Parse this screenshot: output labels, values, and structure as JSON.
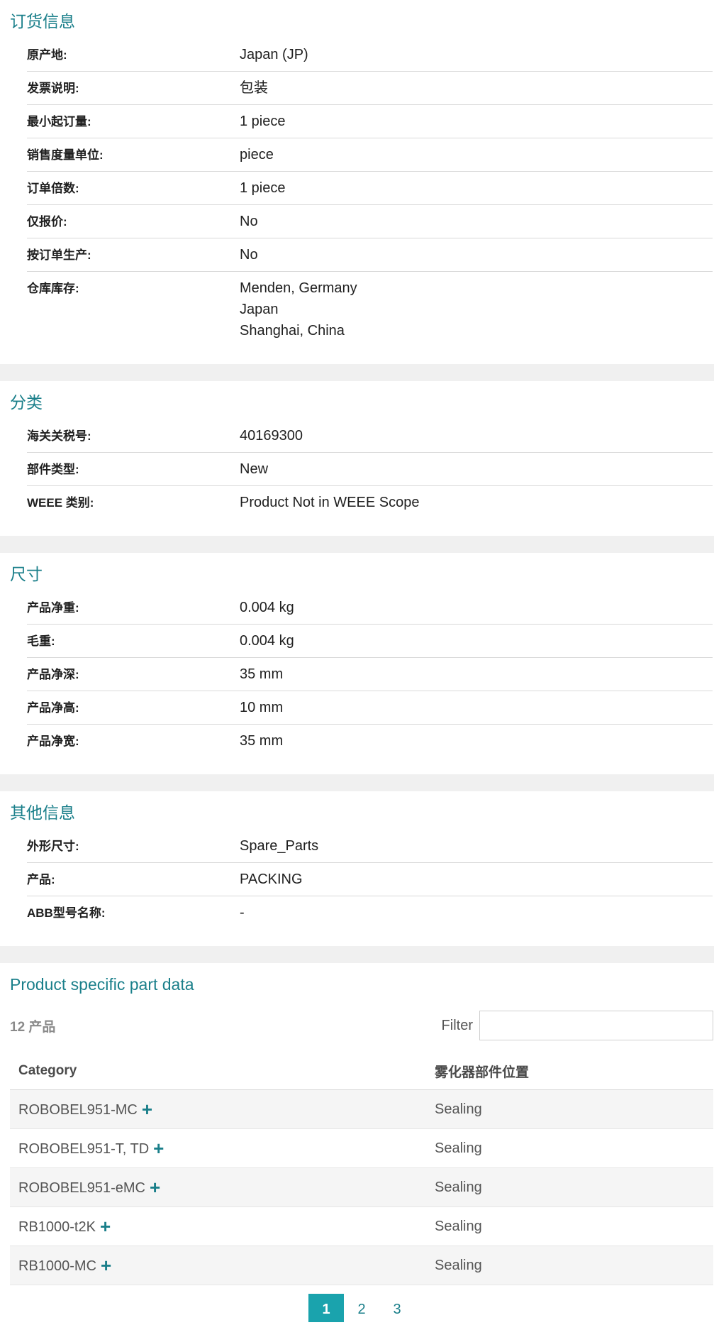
{
  "ordering": {
    "title": "订货信息",
    "rows": [
      {
        "label": "原产地:",
        "values": [
          "Japan (JP)"
        ]
      },
      {
        "label": "发票说明:",
        "values": [
          "包装"
        ]
      },
      {
        "label": "最小起订量:",
        "values": [
          "1 piece"
        ]
      },
      {
        "label": "销售度量单位:",
        "values": [
          "piece"
        ]
      },
      {
        "label": "订单倍数:",
        "values": [
          "1 piece"
        ]
      },
      {
        "label": "仅报价:",
        "values": [
          "No"
        ]
      },
      {
        "label": "按订单生产:",
        "values": [
          "No"
        ]
      },
      {
        "label": "仓库库存:",
        "values": [
          "Menden, Germany",
          "Japan",
          "Shanghai, China"
        ]
      }
    ]
  },
  "classification": {
    "title": "分类",
    "rows": [
      {
        "label": "海关关税号:",
        "values": [
          "40169300"
        ]
      },
      {
        "label": "部件类型:",
        "values": [
          "New"
        ]
      },
      {
        "label": "WEEE 类别:",
        "values": [
          "Product Not in WEEE Scope"
        ]
      }
    ]
  },
  "dimensions": {
    "title": "尺寸",
    "rows": [
      {
        "label": "产品净重:",
        "values": [
          "0.004 kg"
        ]
      },
      {
        "label": "毛重:",
        "values": [
          "0.004 kg"
        ]
      },
      {
        "label": "产品净深:",
        "values": [
          "35 mm"
        ]
      },
      {
        "label": "产品净高:",
        "values": [
          "10 mm"
        ]
      },
      {
        "label": "产品净宽:",
        "values": [
          "35 mm"
        ]
      }
    ]
  },
  "other": {
    "title": "其他信息",
    "rows": [
      {
        "label": "外形尺寸:",
        "values": [
          "Spare_Parts"
        ]
      },
      {
        "label": "产品:",
        "values": [
          "PACKING"
        ]
      },
      {
        "label": "ABB型号名称:",
        "values": [
          "-"
        ]
      }
    ]
  },
  "product_specific": {
    "title": "Product specific part data",
    "count": "12 产品",
    "filter_label": "Filter",
    "filter_value": "",
    "columns": [
      "Category",
      "雾化器部件位置"
    ],
    "rows": [
      {
        "category": "ROBOBEL951-MC",
        "position": "Sealing"
      },
      {
        "category": "ROBOBEL951-T, TD",
        "position": "Sealing"
      },
      {
        "category": "ROBOBEL951-eMC",
        "position": "Sealing"
      },
      {
        "category": "RB1000-t2K",
        "position": "Sealing"
      },
      {
        "category": "RB1000-MC",
        "position": "Sealing"
      }
    ],
    "plus_icon": "+",
    "pages": [
      "1",
      "2",
      "3"
    ],
    "active_page": "1"
  }
}
